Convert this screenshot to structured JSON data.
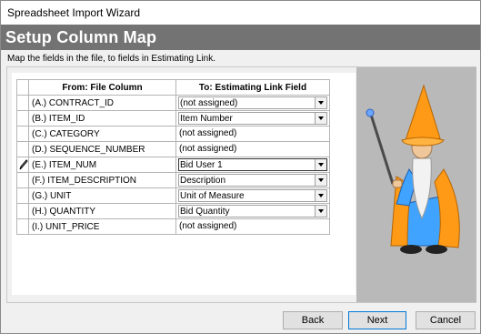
{
  "window": {
    "title": "Spreadsheet Import Wizard"
  },
  "header": {
    "title": "Setup Column Map"
  },
  "instructions": "Map the fields in the file, to fields in Estimating Link.",
  "grid": {
    "headers": {
      "from": "From: File Column",
      "to": "To: Estimating Link Field"
    },
    "rows": [
      {
        "from": "(A.) CONTRACT_ID",
        "to": "(not assigned)",
        "dropdown": true,
        "editing": false
      },
      {
        "from": "(B.) ITEM_ID",
        "to": "Item Number",
        "dropdown": true,
        "editing": false
      },
      {
        "from": "(C.) CATEGORY",
        "to": "(not assigned)",
        "dropdown": false,
        "editing": false
      },
      {
        "from": "(D.) SEQUENCE_NUMBER",
        "to": "(not assigned)",
        "dropdown": false,
        "editing": false
      },
      {
        "from": "(E.) ITEM_NUM",
        "to": "Bid User 1",
        "dropdown": true,
        "editing": true
      },
      {
        "from": "(F.) ITEM_DESCRIPTION",
        "to": "Description",
        "dropdown": true,
        "editing": false
      },
      {
        "from": "(G.) UNIT",
        "to": "Unit of Measure",
        "dropdown": true,
        "editing": false
      },
      {
        "from": "(H.) QUANTITY",
        "to": "Bid Quantity",
        "dropdown": true,
        "editing": false
      },
      {
        "from": "(I.) UNIT_PRICE",
        "to": "(not assigned)",
        "dropdown": false,
        "editing": false
      }
    ]
  },
  "icons": {
    "edit_row": "pencil-icon",
    "dropdown": "chevron-down-icon",
    "illustration": "wizard-illustration"
  },
  "buttons": {
    "back": "Back",
    "next": "Next",
    "cancel": "Cancel"
  },
  "colors": {
    "header_band": "#737373",
    "illustration_bg": "#b9b9b9",
    "default_button_border": "#0078d7"
  }
}
